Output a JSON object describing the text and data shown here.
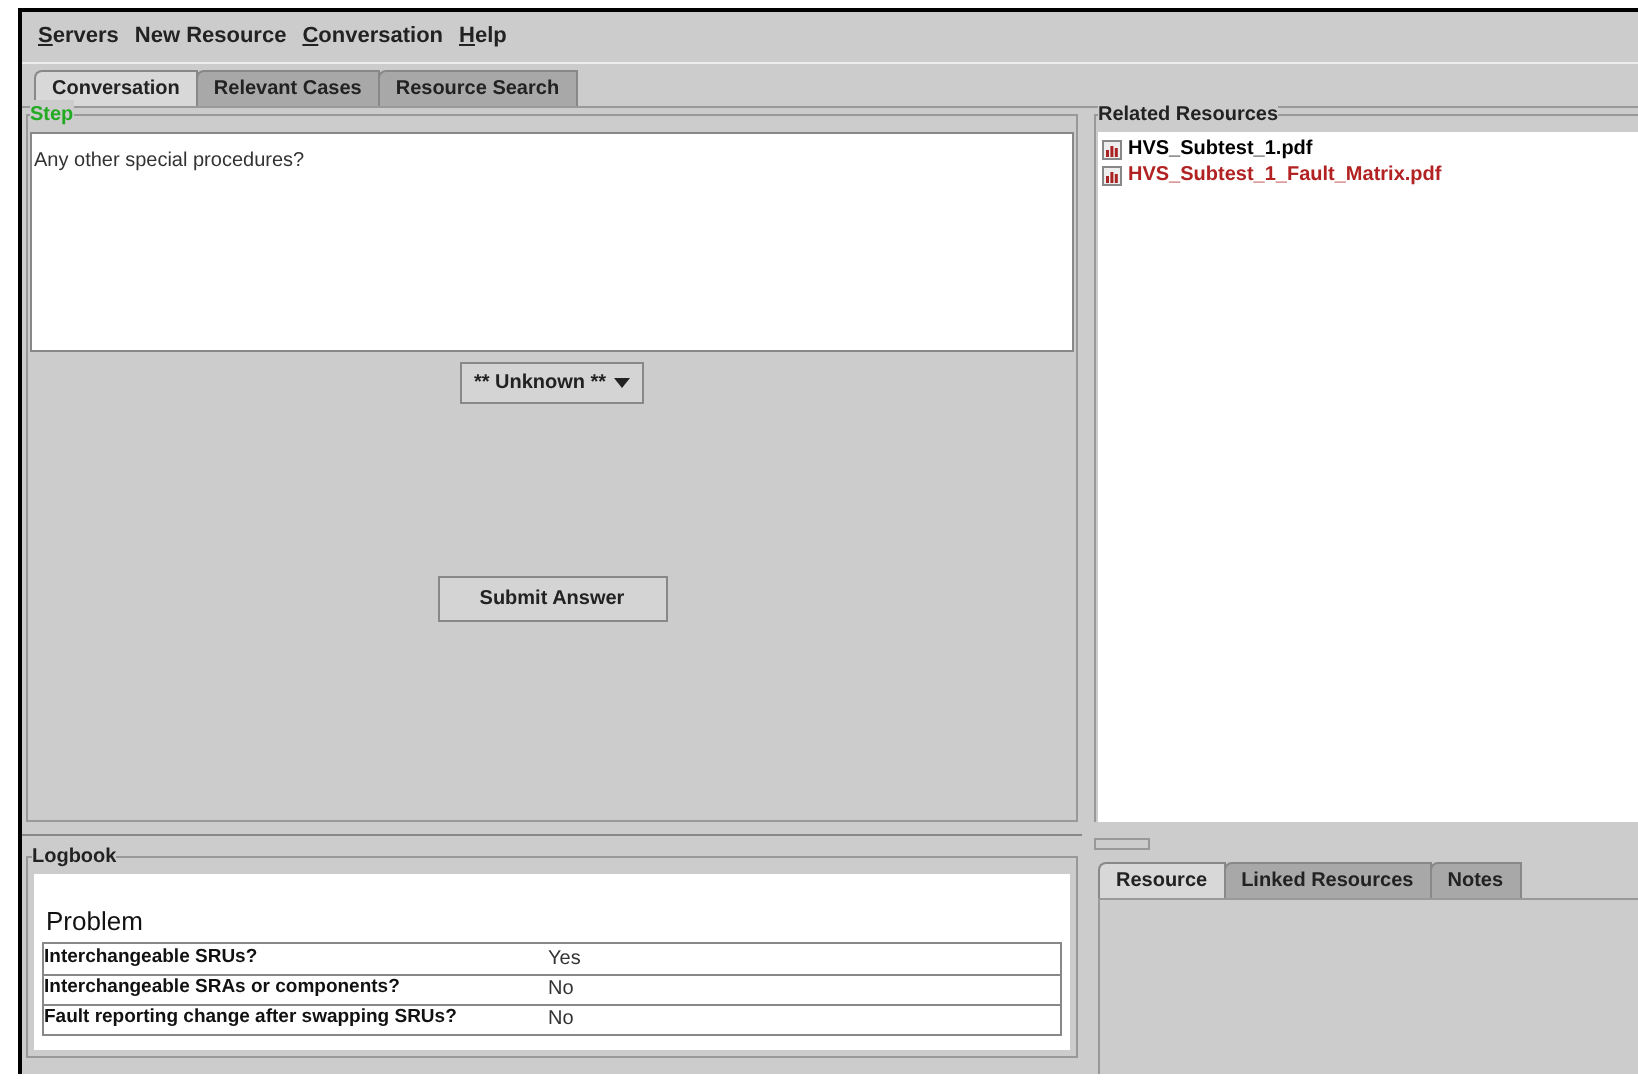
{
  "menu": [
    {
      "label": "Servers",
      "mnemonic": true
    },
    {
      "label": "New Resource",
      "mnemonic": false
    },
    {
      "label": "Conversation",
      "mnemonic": true
    },
    {
      "label": "Help",
      "mnemonic": true
    }
  ],
  "tabs": [
    {
      "label": "Conversation",
      "selected": true
    },
    {
      "label": "Relevant Cases",
      "selected": false
    },
    {
      "label": "Resource Search",
      "selected": false
    }
  ],
  "step": {
    "title": "Step",
    "question": "Any other special procedures?",
    "answer_dropdown": "** Unknown **",
    "submit_button": "Submit Answer"
  },
  "related_resources": {
    "title": "Related Resources",
    "items": [
      {
        "label": "HVS_Subtest_1.pdf",
        "color": "#000000"
      },
      {
        "label": "HVS_Subtest_1_Fault_Matrix.pdf",
        "color": "#b22222"
      }
    ]
  },
  "logbook": {
    "title": "Logbook",
    "heading": "Problem",
    "rows": [
      {
        "question": "Interchangeable SRUs?",
        "answer": "Yes"
      },
      {
        "question": "Interchangeable SRAs or components?",
        "answer": "No"
      },
      {
        "question": "Fault reporting change after swapping SRUs?",
        "answer": "No"
      }
    ]
  },
  "resource_tabs": [
    {
      "label": "Resource",
      "selected": true
    },
    {
      "label": "Linked Resources",
      "selected": false
    },
    {
      "label": "Notes",
      "selected": false
    }
  ]
}
